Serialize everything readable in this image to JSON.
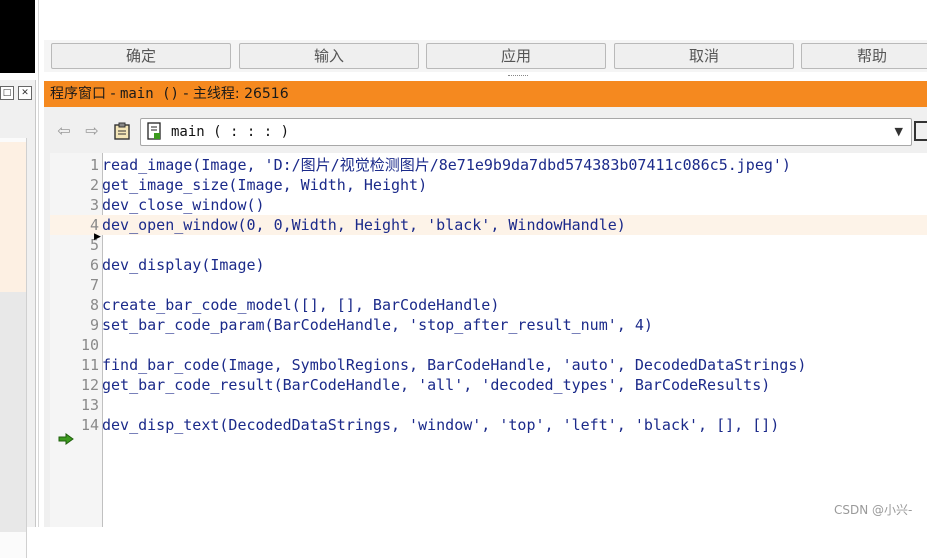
{
  "dialog_buttons": [
    "确定",
    "输入",
    "应用",
    "取消",
    "帮助"
  ],
  "program_window": {
    "title_prefix": "程序窗口 - ",
    "title_proc": "main ()",
    "title_suffix": " - 主线程: 26516",
    "procedure_select": "main ( : : : )"
  },
  "code_lines": [
    {
      "num": "1",
      "text": "read_image(Image, 'D:/图片/视觉检测图片/8e71e9b9da7dbd574383b07411c086c5.jpeg')"
    },
    {
      "num": "2",
      "text": "get_image_size(Image, Width, Height)"
    },
    {
      "num": "3",
      "text": "dev_close_window()"
    },
    {
      "num": "4",
      "text": "dev_open_window(0, 0,Width, Height, 'black', WindowHandle)"
    },
    {
      "num": "5",
      "text": ""
    },
    {
      "num": "6",
      "text": "dev_display(Image)"
    },
    {
      "num": "7",
      "text": ""
    },
    {
      "num": "8",
      "text": "create_bar_code_model([], [], BarCodeHandle)"
    },
    {
      "num": "9",
      "text": "set_bar_code_param(BarCodeHandle, 'stop_after_result_num', 4)"
    },
    {
      "num": "10",
      "text": ""
    },
    {
      "num": "11",
      "text": "find_bar_code(Image, SymbolRegions, BarCodeHandle, 'auto', DecodedDataStrings)"
    },
    {
      "num": "12",
      "text": "get_bar_code_result(BarCodeHandle, 'all', 'decoded_types', BarCodeResults)"
    },
    {
      "num": "13",
      "text": ""
    },
    {
      "num": "14",
      "text": "dev_disp_text(DecodedDataStrings, 'window', 'top', 'left', 'black', [], [])"
    }
  ],
  "watermark": "CSDN @小兴-",
  "colors": {
    "title_bar": "#f5891f",
    "code_text": "#1b2a8a",
    "current_line": "#fdf3e8",
    "pc_arrow": "#3c9a1e"
  }
}
